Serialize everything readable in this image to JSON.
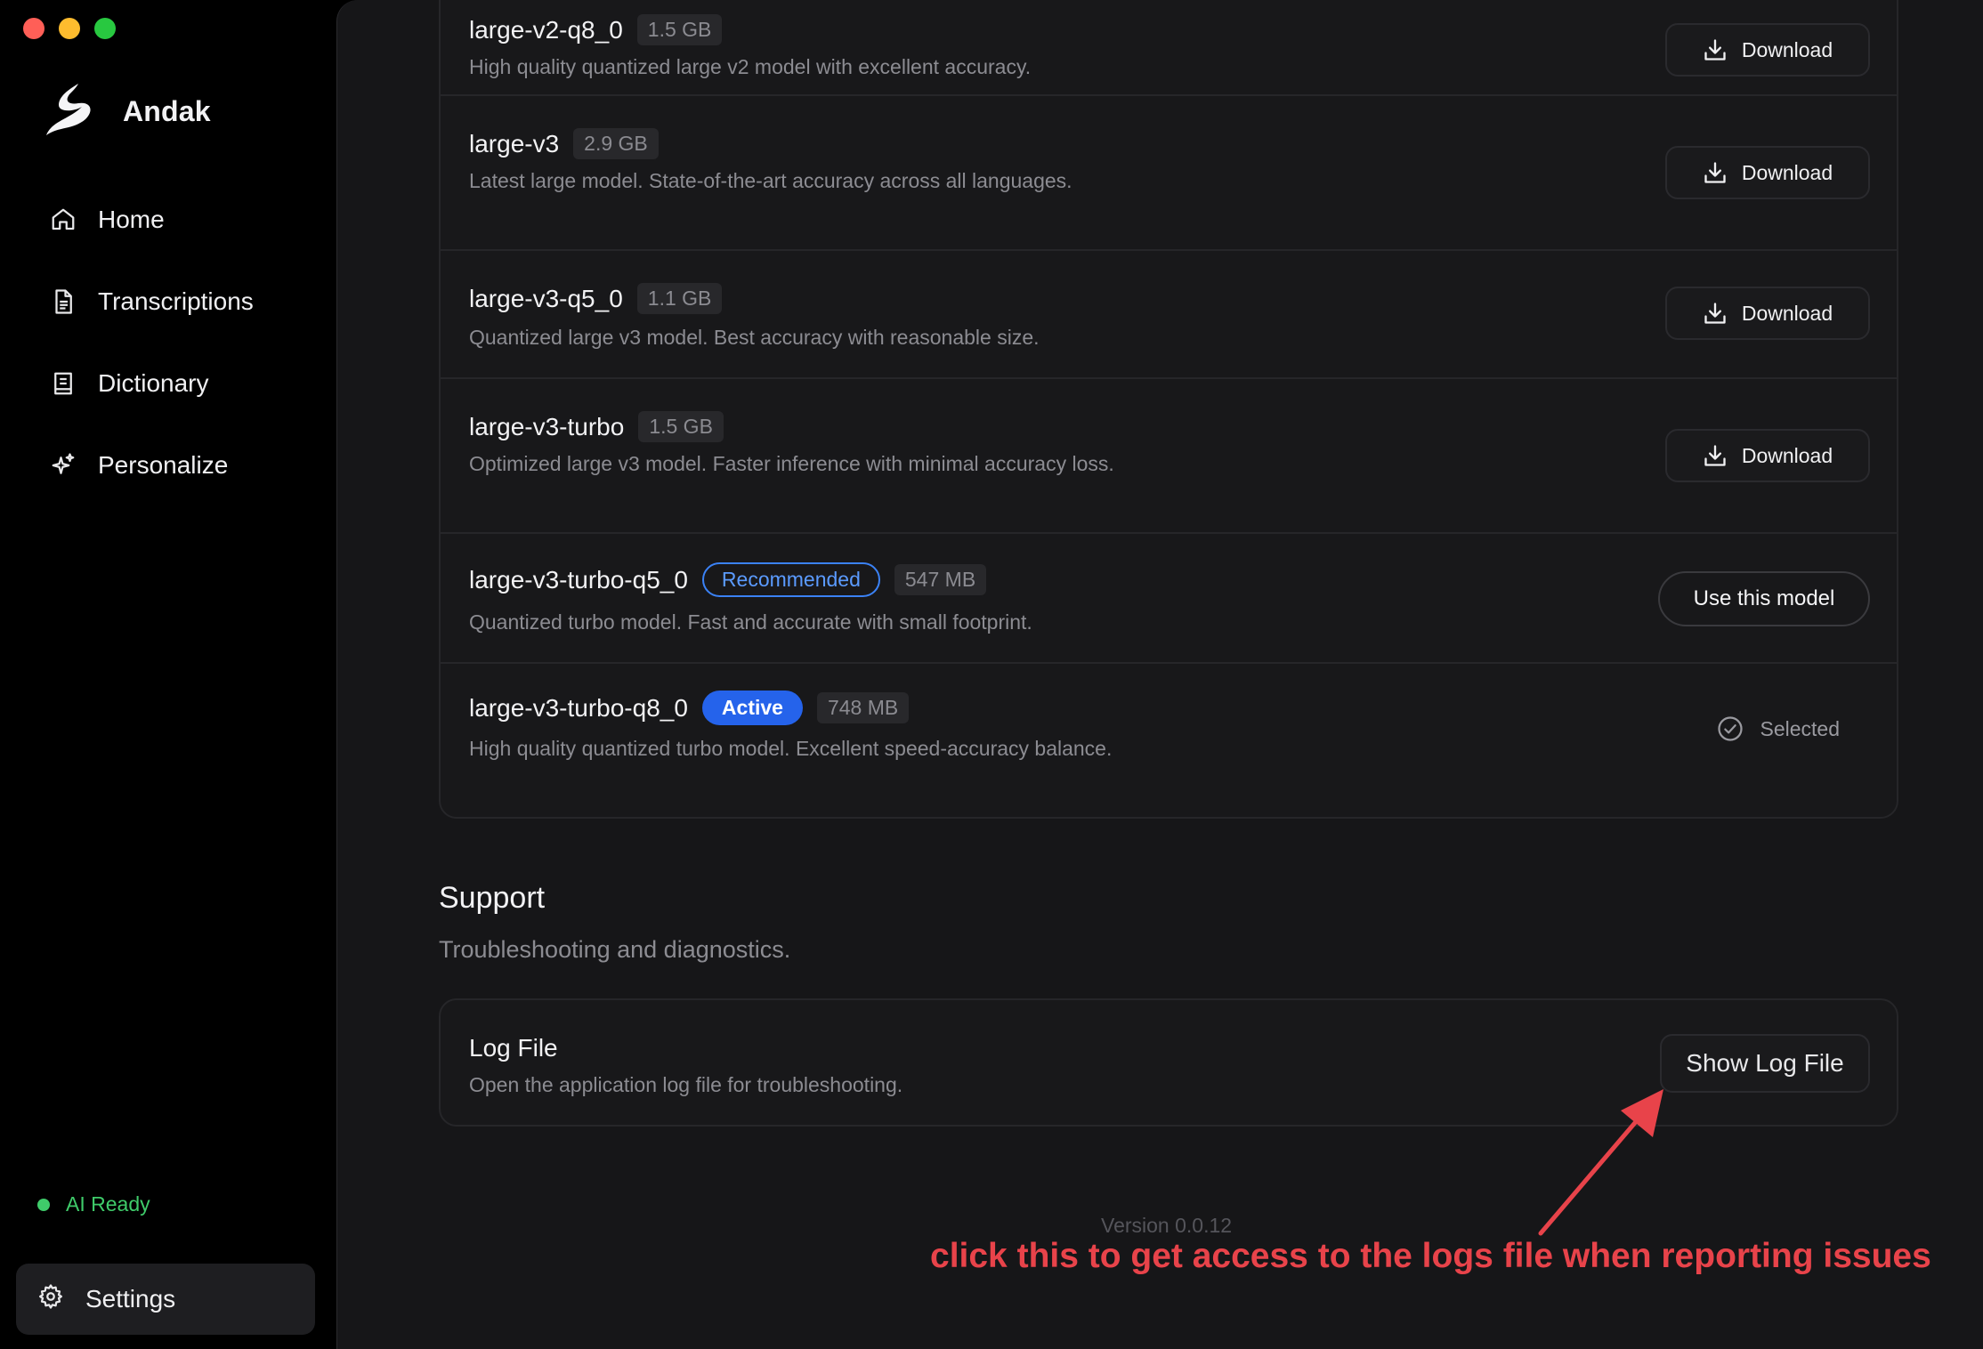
{
  "window": {
    "controls": [
      "close",
      "minimize",
      "maximize"
    ]
  },
  "sidebar": {
    "app_name": "Andak",
    "items": [
      {
        "label": "Home",
        "icon": "home-icon"
      },
      {
        "label": "Transcriptions",
        "icon": "document-icon"
      },
      {
        "label": "Dictionary",
        "icon": "book-icon"
      },
      {
        "label": "Personalize",
        "icon": "sparkles-icon"
      }
    ],
    "status": "AI Ready",
    "settings_label": "Settings"
  },
  "models": [
    {
      "name": "large-v2-q8_0",
      "size": "1.5 GB",
      "description": "High quality quantized large v2 model with excellent accuracy.",
      "action": "Download"
    },
    {
      "name": "large-v3",
      "size": "2.9 GB",
      "description": "Latest large model. State-of-the-art accuracy across all languages.",
      "action": "Download"
    },
    {
      "name": "large-v3-q5_0",
      "size": "1.1 GB",
      "description": "Quantized large v3 model. Best accuracy with reasonable size.",
      "action": "Download"
    },
    {
      "name": "large-v3-turbo",
      "size": "1.5 GB",
      "description": "Optimized large v3 model. Faster inference with minimal accuracy loss.",
      "action": "Download"
    },
    {
      "name": "large-v3-turbo-q5_0",
      "badge": "Recommended",
      "size": "547 MB",
      "description": "Quantized turbo model. Fast and accurate with small footprint.",
      "action": "Use this model"
    },
    {
      "name": "large-v3-turbo-q8_0",
      "badge": "Active",
      "size": "748 MB",
      "description": "High quality quantized turbo model. Excellent speed-accuracy balance.",
      "action": "Selected"
    }
  ],
  "support": {
    "title": "Support",
    "subtitle": "Troubleshooting and diagnostics.",
    "log_title": "Log File",
    "log_description": "Open the application log file for troubleshooting.",
    "log_button": "Show Log File"
  },
  "version": "Version 0.0.12",
  "annotation": "click this to get access to the logs file when reporting issues",
  "colors": {
    "accent": "#2563eb",
    "status": "#3fcb6a",
    "annotation": "#e8434a"
  }
}
